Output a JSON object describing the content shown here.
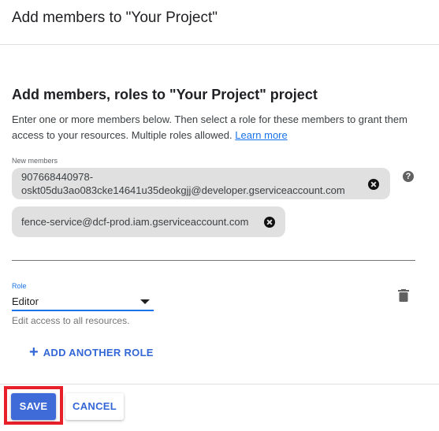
{
  "dialog": {
    "title": "Add members to \"Your Project\""
  },
  "section": {
    "title": "Add members, roles to \"Your Project\" project",
    "description": "Enter one or more members below. Then select a role for these members to grant them access to your resources. Multiple roles allowed.",
    "learn_more": "Learn more"
  },
  "members": {
    "label": "New members",
    "chips": [
      {
        "line1": "907668440978-",
        "line2": "oskt05du3ao083cke14641u35deokgjj@developer.gserviceaccount.com"
      },
      {
        "text": "fence-service@dcf-prod.iam.gserviceaccount.com"
      }
    ],
    "help_icon": "?"
  },
  "role": {
    "label": "Role",
    "value": "Editor",
    "help": "Edit access to all resources."
  },
  "add_role": {
    "plus": "+",
    "label": "ADD ANOTHER ROLE"
  },
  "footer": {
    "save": "SAVE",
    "cancel": "CANCEL"
  },
  "colors": {
    "accent": "#1a73e8",
    "primary_button": "#3f6bd8",
    "highlight": "#e8202a",
    "chip": "#e0e0e0"
  },
  "icons": [
    "close-icon",
    "help-icon",
    "dropdown-icon",
    "trash-icon",
    "plus-icon"
  ]
}
